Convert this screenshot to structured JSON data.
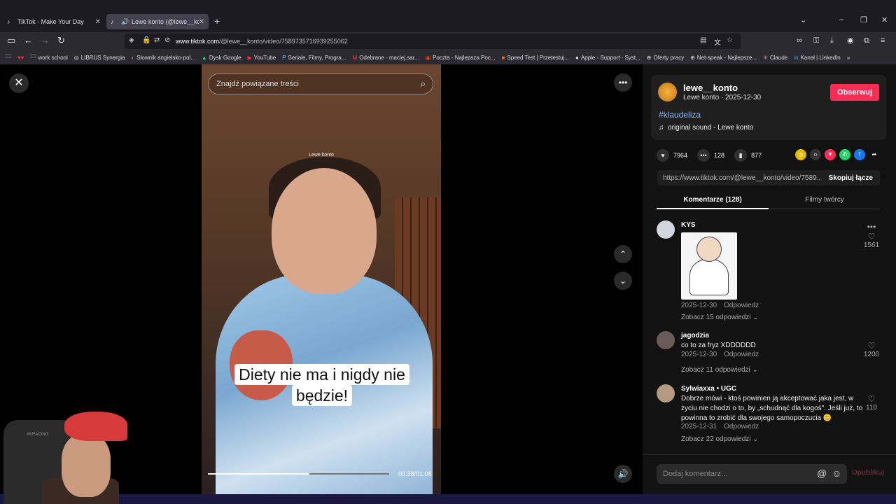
{
  "browser": {
    "tabs": [
      {
        "title": "TikTok - Make Your Day",
        "icon": "tiktok-icon"
      },
      {
        "title": "Lewe konto (@lewe__konto",
        "icon": "tiktok-icon"
      }
    ],
    "url_domain": "www.tiktok.com",
    "url_path": "/@lewe__konto/video/7589735716939255062",
    "bookmarks": [
      "work school",
      "LIBRUS Synergia",
      "Słownik angielsko-pol...",
      "Dysk Google",
      "YouTube",
      "Seriale, Filmy, Progra...",
      "Odebrane - maciej.sar...",
      "Poczta - Najlepsza Poc...",
      "Speed Test | Przetestuj...",
      "Apple - Support - Syst...",
      "Oferty pracy",
      "Net-speak - Najlepsze...",
      "Claude",
      "Kanał | LinkedIn"
    ]
  },
  "player": {
    "search_placeholder": "Znajdź powiązane treści",
    "video_author_watermark": "Lewe konto",
    "caption": "Diety nie ma i nigdy nie będzie!",
    "time": "00:38/01:08",
    "progress": 0.56
  },
  "webcam": {
    "chair_brand": "AKRACING"
  },
  "sidebar": {
    "username": "lewe__konto",
    "subline": "Lewe konto · 2025-12-30",
    "follow_label": "Obserwuj",
    "hashtag": "#klaudeliza",
    "sound": "original sound - Lewe konto",
    "likes": "7964",
    "comments": "128",
    "saves": "877",
    "link": "https://www.tiktok.com/@lewe__konto/video/7589...",
    "copy_label": "Skopiuj łącze",
    "tab_comments": "Komentarze (128)",
    "tab_creator": "Filmy twórcy",
    "comment_list": [
      {
        "name": "KYS",
        "text": "",
        "date": "2025-12-30",
        "reply": "Odpowiedz",
        "replies": "Zobacz 15 odpowiedzi",
        "likes": "1561"
      },
      {
        "name": "jagodzia",
        "text": "co to za fryz XDDDDDD",
        "date": "2025-12-30",
        "reply": "Odpowiedz",
        "replies": "Zobacz 11 odpowiedzi",
        "likes": "1200"
      },
      {
        "name": "Sylwiaxxa • UGC",
        "text": "Dobrze mówi - ktoś powinien ją akceptować jaka jest, w życiu nie chodzi o to, by „schudnąć dla kogoś\". Jeśli już, to powinna to zrobić dla swojego samopoczucia 😊",
        "date": "2025-12-31",
        "reply": "Odpowiedz",
        "replies": "Zobacz 22 odpowiedzi",
        "likes": "110"
      }
    ],
    "input_placeholder": "Dodaj komentarz...",
    "post_label": "Opublikuj"
  },
  "colors": {
    "accent": "#fe2c55",
    "hashtag": "#8fb8ff"
  }
}
